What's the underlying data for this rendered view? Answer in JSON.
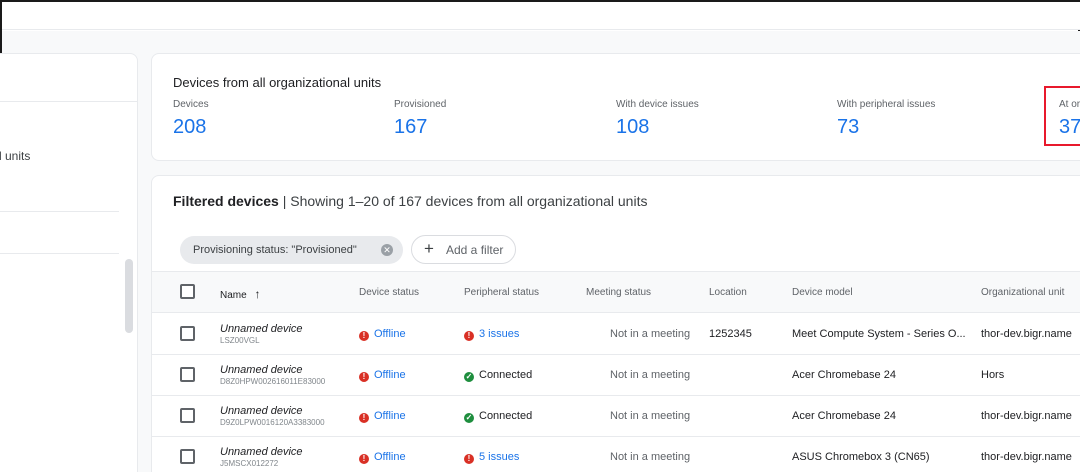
{
  "left_panel": {
    "units_label": "l units"
  },
  "summary": {
    "title": "Devices from all organizational units",
    "stats": [
      {
        "label": "Devices",
        "value": "208"
      },
      {
        "label": "Provisioned",
        "value": "167"
      },
      {
        "label": "With device issues",
        "value": "108"
      },
      {
        "label": "With peripheral issues",
        "value": "73"
      },
      {
        "label": "At or",
        "value": "37"
      }
    ]
  },
  "devices": {
    "header_bold": "Filtered devices",
    "header_rest": " | Showing 1–20 of 167 devices from all organizational units",
    "filter_chip": "Provisioning status: \"Provisioned\"",
    "add_filter": "Add a filter",
    "columns": {
      "name": "Name",
      "device_status": "Device status",
      "peripheral_status": "Peripheral status",
      "meeting_status": "Meeting status",
      "location": "Location",
      "device_model": "Device model",
      "org_unit": "Organizational unit"
    },
    "rows": [
      {
        "name": "Unnamed device",
        "serial": "LSZ00VGL",
        "device_status": "Offline",
        "peripheral_status": "3 issues",
        "peripheral_ok": false,
        "meeting_status": "Not in a meeting",
        "location": "1252345",
        "model": "Meet Compute System - Series O...",
        "org_unit": "thor-dev.bigr.name"
      },
      {
        "name": "Unnamed device",
        "serial": "D8Z0HPW002616011E83000",
        "device_status": "Offline",
        "peripheral_status": "Connected",
        "peripheral_ok": true,
        "meeting_status": "Not in a meeting",
        "location": "",
        "model": "Acer Chromebase 24",
        "org_unit": "Hors"
      },
      {
        "name": "Unnamed device",
        "serial": "D9Z0LPW0016120A3383000",
        "device_status": "Offline",
        "peripheral_status": "Connected",
        "peripheral_ok": true,
        "meeting_status": "Not in a meeting",
        "location": "",
        "model": "Acer Chromebase 24",
        "org_unit": "thor-dev.bigr.name"
      },
      {
        "name": "Unnamed device",
        "serial": "J5MSCX012272",
        "device_status": "Offline",
        "peripheral_status": "5 issues",
        "peripheral_ok": false,
        "meeting_status": "Not in a meeting",
        "location": "",
        "model": "ASUS Chromebox 3 (CN65)",
        "org_unit": "thor-dev.bigr.name"
      }
    ]
  },
  "colors": {
    "accent": "#1a73e8",
    "error": "#d93025",
    "success": "#1e8e3e",
    "highlight": "#e8192c"
  }
}
